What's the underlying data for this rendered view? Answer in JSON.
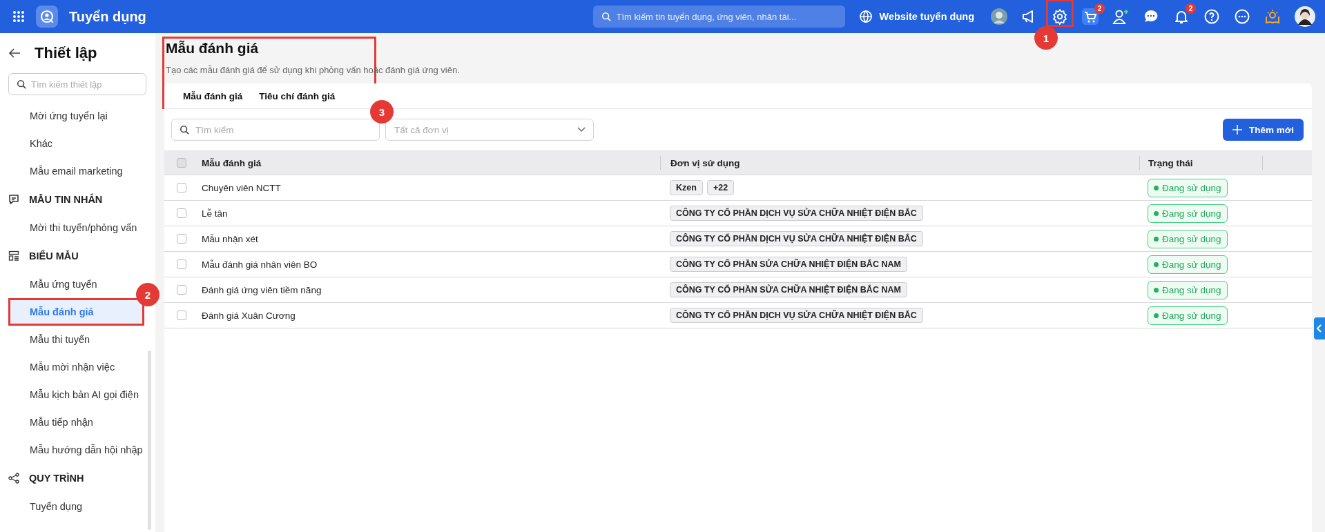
{
  "topbar": {
    "app_name": "Tuyển dụng",
    "search": {
      "placeholder": "Tìm kiếm tin tuyển dụng, ứng viên, nhân tài..."
    },
    "website_link": "Website tuyển dụng",
    "icons": [
      {
        "kind": "robot-avatar"
      },
      {
        "kind": "megaphone"
      },
      {
        "kind": "settings",
        "annotation": "1"
      },
      {
        "kind": "cart",
        "badge": "2"
      },
      {
        "kind": "add-user"
      },
      {
        "kind": "chat"
      },
      {
        "kind": "bell",
        "badge": "2"
      },
      {
        "kind": "help"
      },
      {
        "kind": "more"
      },
      {
        "kind": "lightbulb-book"
      },
      {
        "kind": "profile-avatar"
      }
    ]
  },
  "sidebar": {
    "title": "Thiết lập",
    "search": {
      "placeholder": "Tìm kiếm thiết lập"
    },
    "groups": [
      {
        "items": [
          {
            "label": "Mời ứng tuyển lại",
            "selected": false
          },
          {
            "label": "Khác",
            "selected": false
          },
          {
            "label": "Mẫu email marketing",
            "selected": false
          }
        ]
      },
      {
        "heading": "MẪU TIN NHẮN",
        "items": [
          {
            "label": "Mời thi tuyển/phỏng vấn",
            "selected": false
          }
        ]
      },
      {
        "heading": "BIỂU MẪU",
        "items": [
          {
            "label": "Mẫu ứng tuyển",
            "selected": false
          },
          {
            "label": "Mẫu đánh giá",
            "selected": true,
            "annotation": "2"
          },
          {
            "label": "Mẫu thi tuyển",
            "selected": false
          },
          {
            "label": "Mẫu mời nhận việc",
            "selected": false
          },
          {
            "label": "Mẫu kịch bản AI gọi điện",
            "selected": false
          },
          {
            "label": "Mẫu tiếp nhận",
            "selected": false
          },
          {
            "label": "Mẫu hướng dẫn hội nhập",
            "selected": false
          }
        ]
      },
      {
        "heading": "QUY TRÌNH",
        "items": [
          {
            "label": "Tuyển dụng",
            "selected": false
          }
        ]
      }
    ]
  },
  "main": {
    "title": "Mẫu đánh giá",
    "subtitle": "Tạo các mẫu đánh giá để sử dụng khi phỏng vấn hoặc đánh giá ứng viên.",
    "annotation": "3",
    "tabs": [
      {
        "label": "Mẫu đánh giá"
      },
      {
        "label": "Tiêu chí đánh giá"
      }
    ],
    "search": {
      "placeholder": "Tìm kiếm"
    },
    "unit_filter": {
      "placeholder": "Tất cả đơn vị"
    },
    "add_button": "Thêm mới",
    "table": {
      "columns": [
        "Mẫu đánh giá",
        "Đơn vị sử dụng",
        "Trạng thái"
      ],
      "header_checked": false,
      "rows": [
        {
          "checked": false,
          "name": "Chuyên viên NCTT",
          "units": [
            "Kzen",
            "+22"
          ],
          "status": "Đang sử dụng"
        },
        {
          "checked": false,
          "name": "Lễ tân",
          "units": [
            "CÔNG TY CỔ PHẦN DỊCH VỤ SỬA CHỮA NHIỆT ĐIỆN BẮC"
          ],
          "status": "Đang sử dụng"
        },
        {
          "checked": false,
          "name": "Mẫu nhận xét",
          "units": [
            "CÔNG TY CỔ PHẦN DỊCH VỤ SỬA CHỮA NHIỆT ĐIỆN BẮC"
          ],
          "status": "Đang sử dụng"
        },
        {
          "checked": false,
          "name": "Mẫu đánh giá nhân viên BO",
          "units": [
            "CÔNG TY CỔ PHẦN SỬA CHỮA NHIỆT ĐIỆN BẮC NAM"
          ],
          "status": "Đang sử dụng"
        },
        {
          "checked": false,
          "name": "Đánh giá ứng viên tiềm năng",
          "units": [
            "CÔNG TY CỔ PHẦN SỬA CHỮA NHIỆT ĐIỆN BẮC NAM"
          ],
          "status": "Đang sử dụng"
        },
        {
          "checked": false,
          "name": "Đánh giá Xuân Cương",
          "units": [
            "CÔNG TY CỔ PHẦN DỊCH VỤ SỬA CHỮA NHIỆT ĐIỆN BẮC"
          ],
          "status": "Đang sử dụng"
        }
      ]
    }
  }
}
